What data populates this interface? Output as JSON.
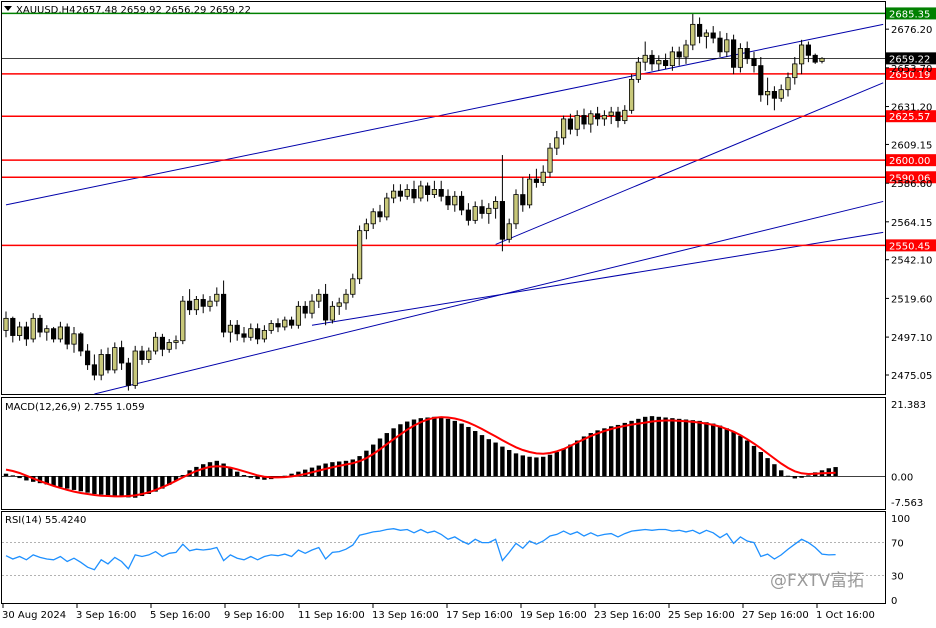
{
  "header": {
    "symbol": "XAUUSD,H4",
    "ohlc": "2657.48 2659.92 2656.29 2659.22"
  },
  "watermark": "@FXTV富拓",
  "colors": {
    "bull_body": "#c8c87a",
    "bear_body": "#000000",
    "support_resistance": "#ff0000",
    "top_line": "#008000",
    "trend_line": "#0000aa",
    "macd_signal": "#ff0000",
    "rsi": "#1e90ff"
  },
  "chart_data": [
    {
      "type": "candlestick",
      "panel": "price",
      "ylim": [
        2464,
        2692
      ],
      "y_ticks": [
        "2676.20",
        "2653.70",
        "2631.20",
        "2609.15",
        "2586.60",
        "2564.15",
        "2542.10",
        "2519.60",
        "2497.10",
        "2475.05"
      ],
      "horizontal_levels": [
        {
          "value": 2685.35,
          "label": "2685.35",
          "color": "#008000"
        },
        {
          "value": 2659.22,
          "label": "2659.22",
          "color": "#000000"
        },
        {
          "value": 2650.19,
          "label": "2650.19",
          "color": "#ff0000"
        },
        {
          "value": 2625.57,
          "label": "2625.57",
          "color": "#ff0000"
        },
        {
          "value": 2600.0,
          "label": "2600.00",
          "color": "#ff0000"
        },
        {
          "value": 2590.06,
          "label": "2590.06",
          "color": "#ff0000"
        },
        {
          "value": 2550.45,
          "label": "2550.45",
          "color": "#ff0000"
        }
      ],
      "candles": [
        [
          2501,
          2512,
          2497,
          2508
        ],
        [
          2508,
          2509,
          2494,
          2498
        ],
        [
          2498,
          2506,
          2495,
          2503
        ],
        [
          2503,
          2506,
          2492,
          2496
        ],
        [
          2496,
          2511,
          2494,
          2508
        ],
        [
          2508,
          2510,
          2497,
          2500
        ],
        [
          2500,
          2504,
          2495,
          2502
        ],
        [
          2502,
          2503,
          2494,
          2496
        ],
        [
          2496,
          2506,
          2494,
          2503
        ],
        [
          2503,
          2505,
          2490,
          2493
        ],
        [
          2493,
          2503,
          2488,
          2499
        ],
        [
          2499,
          2500,
          2486,
          2489
        ],
        [
          2489,
          2493,
          2478,
          2481
        ],
        [
          2481,
          2487,
          2472,
          2475
        ],
        [
          2475,
          2490,
          2472,
          2487
        ],
        [
          2487,
          2491,
          2476,
          2478
        ],
        [
          2478,
          2494,
          2476,
          2491
        ],
        [
          2491,
          2495,
          2478,
          2482
        ],
        [
          2482,
          2485,
          2466,
          2469
        ],
        [
          2469,
          2492,
          2467,
          2489
        ],
        [
          2489,
          2492,
          2481,
          2484
        ],
        [
          2484,
          2491,
          2482,
          2489
        ],
        [
          2489,
          2500,
          2487,
          2497
        ],
        [
          2497,
          2499,
          2486,
          2490
        ],
        [
          2490,
          2496,
          2488,
          2494
        ],
        [
          2494,
          2498,
          2490,
          2495
        ],
        [
          2495,
          2521,
          2493,
          2518
        ],
        [
          2518,
          2525,
          2510,
          2513
        ],
        [
          2513,
          2521,
          2510,
          2519
        ],
        [
          2519,
          2522,
          2511,
          2515
        ],
        [
          2515,
          2521,
          2512,
          2518
        ],
        [
          2518,
          2526,
          2515,
          2522
        ],
        [
          2522,
          2530,
          2497,
          2500
        ],
        [
          2500,
          2507,
          2494,
          2504
        ],
        [
          2504,
          2507,
          2495,
          2499
        ],
        [
          2499,
          2503,
          2494,
          2497
        ],
        [
          2497,
          2505,
          2495,
          2502
        ],
        [
          2502,
          2505,
          2493,
          2496
        ],
        [
          2496,
          2504,
          2494,
          2501
        ],
        [
          2501,
          2507,
          2499,
          2505
        ],
        [
          2505,
          2508,
          2500,
          2503
        ],
        [
          2503,
          2509,
          2501,
          2507
        ],
        [
          2507,
          2509,
          2502,
          2504
        ],
        [
          2504,
          2518,
          2502,
          2515
        ],
        [
          2515,
          2518,
          2508,
          2511
        ],
        [
          2511,
          2522,
          2508,
          2518
        ],
        [
          2518,
          2525,
          2514,
          2522
        ],
        [
          2522,
          2528,
          2504,
          2507
        ],
        [
          2507,
          2518,
          2505,
          2515
        ],
        [
          2515,
          2520,
          2510,
          2517
        ],
        [
          2517,
          2525,
          2513,
          2522
        ],
        [
          2522,
          2534,
          2520,
          2531
        ],
        [
          2531,
          2562,
          2528,
          2559
        ],
        [
          2559,
          2566,
          2554,
          2563
        ],
        [
          2563,
          2572,
          2560,
          2570
        ],
        [
          2570,
          2574,
          2564,
          2567
        ],
        [
          2567,
          2581,
          2565,
          2578
        ],
        [
          2578,
          2586,
          2575,
          2582
        ],
        [
          2582,
          2586,
          2576,
          2579
        ],
        [
          2579,
          2586,
          2577,
          2583
        ],
        [
          2583,
          2588,
          2575,
          2578
        ],
        [
          2578,
          2588,
          2576,
          2585
        ],
        [
          2585,
          2587,
          2576,
          2580
        ],
        [
          2580,
          2588,
          2578,
          2583
        ],
        [
          2583,
          2588,
          2576,
          2579
        ],
        [
          2579,
          2583,
          2571,
          2574
        ],
        [
          2574,
          2582,
          2570,
          2579
        ],
        [
          2579,
          2582,
          2568,
          2571
        ],
        [
          2571,
          2575,
          2562,
          2565
        ],
        [
          2565,
          2576,
          2563,
          2573
        ],
        [
          2573,
          2577,
          2566,
          2569
        ],
        [
          2569,
          2575,
          2563,
          2572
        ],
        [
          2572,
          2579,
          2566,
          2576
        ],
        [
          2576,
          2603,
          2547,
          2554
        ],
        [
          2554,
          2566,
          2552,
          2563
        ],
        [
          2563,
          2583,
          2560,
          2580
        ],
        [
          2580,
          2590,
          2570,
          2574
        ],
        [
          2574,
          2592,
          2572,
          2589
        ],
        [
          2589,
          2595,
          2584,
          2587
        ],
        [
          2587,
          2597,
          2585,
          2593
        ],
        [
          2593,
          2610,
          2590,
          2607
        ],
        [
          2607,
          2617,
          2603,
          2613
        ],
        [
          2613,
          2626,
          2609,
          2624
        ],
        [
          2624,
          2627,
          2615,
          2618
        ],
        [
          2618,
          2629,
          2614,
          2626
        ],
        [
          2626,
          2630,
          2618,
          2621
        ],
        [
          2621,
          2629,
          2616,
          2627
        ],
        [
          2627,
          2631,
          2620,
          2624
        ],
        [
          2624,
          2629,
          2620,
          2626
        ],
        [
          2626,
          2631,
          2621,
          2628
        ],
        [
          2628,
          2631,
          2619,
          2623
        ],
        [
          2623,
          2632,
          2621,
          2629
        ],
        [
          2629,
          2650,
          2627,
          2647
        ],
        [
          2647,
          2660,
          2645,
          2657
        ],
        [
          2657,
          2669,
          2652,
          2661
        ],
        [
          2661,
          2664,
          2652,
          2656
        ],
        [
          2656,
          2661,
          2652,
          2658
        ],
        [
          2658,
          2662,
          2653,
          2655
        ],
        [
          2655,
          2666,
          2652,
          2663
        ],
        [
          2663,
          2666,
          2655,
          2660
        ],
        [
          2660,
          2670,
          2656,
          2667
        ],
        [
          2667,
          2685,
          2664,
          2679
        ],
        [
          2679,
          2683,
          2668,
          2672
        ],
        [
          2672,
          2676,
          2665,
          2674
        ],
        [
          2674,
          2678,
          2668,
          2671
        ],
        [
          2671,
          2675,
          2660,
          2663
        ],
        [
          2663,
          2674,
          2660,
          2670
        ],
        [
          2670,
          2673,
          2650,
          2654
        ],
        [
          2654,
          2668,
          2651,
          2665
        ],
        [
          2665,
          2669,
          2656,
          2659
        ],
        [
          2659,
          2663,
          2651,
          2655
        ],
        [
          2655,
          2660,
          2634,
          2638
        ],
        [
          2638,
          2648,
          2632,
          2640
        ],
        [
          2640,
          2643,
          2629,
          2636
        ],
        [
          2636,
          2644,
          2634,
          2641
        ],
        [
          2641,
          2651,
          2637,
          2648
        ],
        [
          2648,
          2660,
          2644,
          2656
        ],
        [
          2656,
          2670,
          2650,
          2667
        ],
        [
          2667,
          2669,
          2657,
          2661
        ],
        [
          2661,
          2662,
          2656,
          2657
        ],
        [
          2657.48,
          2659.92,
          2656.29,
          2659.22
        ]
      ]
    },
    {
      "type": "bar",
      "panel": "macd",
      "label": "MACD(12,26,9) 2.755 1.059",
      "ylim": [
        -7.563,
        21.383
      ],
      "y_ticks": [
        "21.383",
        "0.00",
        "-7.563"
      ],
      "histogram": [
        0.8,
        0.3,
        -0.5,
        -1.2,
        -1.6,
        -2.0,
        -2.4,
        -2.8,
        -3.2,
        -3.6,
        -4.0,
        -4.4,
        -4.8,
        -5.2,
        -5.4,
        -5.6,
        -5.8,
        -6.0,
        -6.2,
        -6.3,
        -5.8,
        -5.2,
        -4.5,
        -3.6,
        -2.5,
        -1.2,
        0.4,
        1.8,
        2.8,
        3.6,
        4.2,
        4.6,
        3.8,
        2.6,
        1.4,
        0.4,
        -0.4,
        -0.8,
        -1.0,
        -0.8,
        -0.4,
        0.2,
        0.8,
        1.4,
        2.0,
        2.6,
        3.2,
        3.8,
        4.2,
        4.4,
        4.6,
        5.0,
        6.0,
        7.6,
        9.4,
        11.2,
        12.8,
        14.2,
        15.4,
        16.2,
        16.8,
        17.2,
        17.4,
        17.6,
        17.4,
        17.0,
        16.4,
        15.6,
        14.6,
        13.4,
        12.2,
        11.0,
        10.0,
        8.8,
        7.8,
        6.8,
        6.2,
        5.8,
        5.6,
        5.8,
        6.4,
        7.2,
        8.2,
        9.4,
        10.6,
        11.8,
        12.8,
        13.6,
        14.2,
        14.8,
        15.2,
        15.8,
        16.4,
        17.0,
        17.6,
        17.8,
        17.6,
        17.4,
        17.2,
        17.0,
        16.8,
        16.6,
        16.4,
        16.0,
        15.6,
        15.0,
        14.2,
        13.2,
        12.0,
        10.6,
        9.0,
        7.2,
        5.4,
        3.6,
        1.8,
        0.2,
        -0.6,
        -0.4,
        0.3,
        1.2,
        1.8,
        2.4,
        2.755
      ],
      "signal": [
        2.0,
        1.6,
        1.0,
        0.2,
        -0.6,
        -1.4,
        -2.1,
        -2.8,
        -3.4,
        -4.0,
        -4.5,
        -4.9,
        -5.2,
        -5.5,
        -5.7,
        -5.8,
        -5.9,
        -5.9,
        -5.8,
        -5.6,
        -5.2,
        -4.7,
        -4.0,
        -3.2,
        -2.3,
        -1.3,
        -0.3,
        0.7,
        1.6,
        2.3,
        2.8,
        3.0,
        2.9,
        2.6,
        2.1,
        1.5,
        0.9,
        0.3,
        -0.1,
        -0.3,
        -0.3,
        -0.2,
        0.0,
        0.3,
        0.7,
        1.2,
        1.7,
        2.2,
        2.7,
        3.1,
        3.5,
        3.9,
        4.5,
        5.4,
        6.6,
        8.0,
        9.5,
        11.0,
        12.4,
        13.8,
        15.0,
        16.0,
        16.8,
        17.3,
        17.5,
        17.4,
        17.1,
        16.6,
        15.9,
        15.0,
        14.0,
        12.9,
        11.8,
        10.7,
        9.6,
        8.6,
        7.8,
        7.2,
        6.8,
        6.7,
        6.9,
        7.4,
        8.1,
        9.0,
        10.0,
        11.0,
        11.9,
        12.7,
        13.4,
        14.0,
        14.5,
        14.9,
        15.3,
        15.6,
        15.9,
        16.2,
        16.4,
        16.5,
        16.5,
        16.4,
        16.3,
        16.1,
        15.9,
        15.6,
        15.2,
        14.7,
        14.0,
        13.2,
        12.2,
        11.0,
        9.7,
        8.3,
        6.8,
        5.3,
        3.8,
        2.5,
        1.5,
        0.9,
        0.7,
        0.8,
        0.9,
        1.0,
        1.059
      ]
    },
    {
      "type": "line",
      "panel": "rsi",
      "label": "RSI(14) 55.4240",
      "ylim": [
        0,
        100
      ],
      "y_ticks": [
        "100",
        "70",
        "30",
        "0"
      ],
      "values": [
        54,
        50,
        53,
        49,
        55,
        52,
        50,
        49,
        53,
        47,
        51,
        46,
        40,
        37,
        49,
        44,
        52,
        47,
        38,
        55,
        53,
        55,
        59,
        53,
        57,
        58,
        68,
        60,
        62,
        61,
        62,
        64,
        48,
        55,
        51,
        49,
        53,
        49,
        53,
        55,
        54,
        56,
        53,
        61,
        57,
        61,
        64,
        50,
        58,
        59,
        62,
        67,
        79,
        81,
        83,
        84,
        86,
        87,
        85,
        86,
        82,
        86,
        82,
        84,
        80,
        74,
        77,
        72,
        68,
        74,
        70,
        70,
        74,
        48,
        58,
        69,
        63,
        72,
        68,
        72,
        78,
        80,
        84,
        80,
        83,
        78,
        82,
        78,
        80,
        81,
        77,
        81,
        84,
        85,
        86,
        85,
        86,
        86,
        84,
        85,
        83,
        85,
        81,
        85,
        82,
        76,
        81,
        69,
        77,
        72,
        70,
        53,
        56,
        50,
        55,
        62,
        68,
        74,
        70,
        64,
        56,
        55,
        55.424
      ]
    }
  ],
  "x_axis": {
    "labels": [
      "30 Aug 2024",
      "3 Sep 16:00",
      "5 Sep 16:00",
      "9 Sep 16:00",
      "11 Sep 16:00",
      "13 Sep 16:00",
      "17 Sep 16:00",
      "19 Sep 16:00",
      "23 Sep 16:00",
      "25 Sep 16:00",
      "27 Sep 16:00",
      "1 Oct 16:00"
    ]
  }
}
